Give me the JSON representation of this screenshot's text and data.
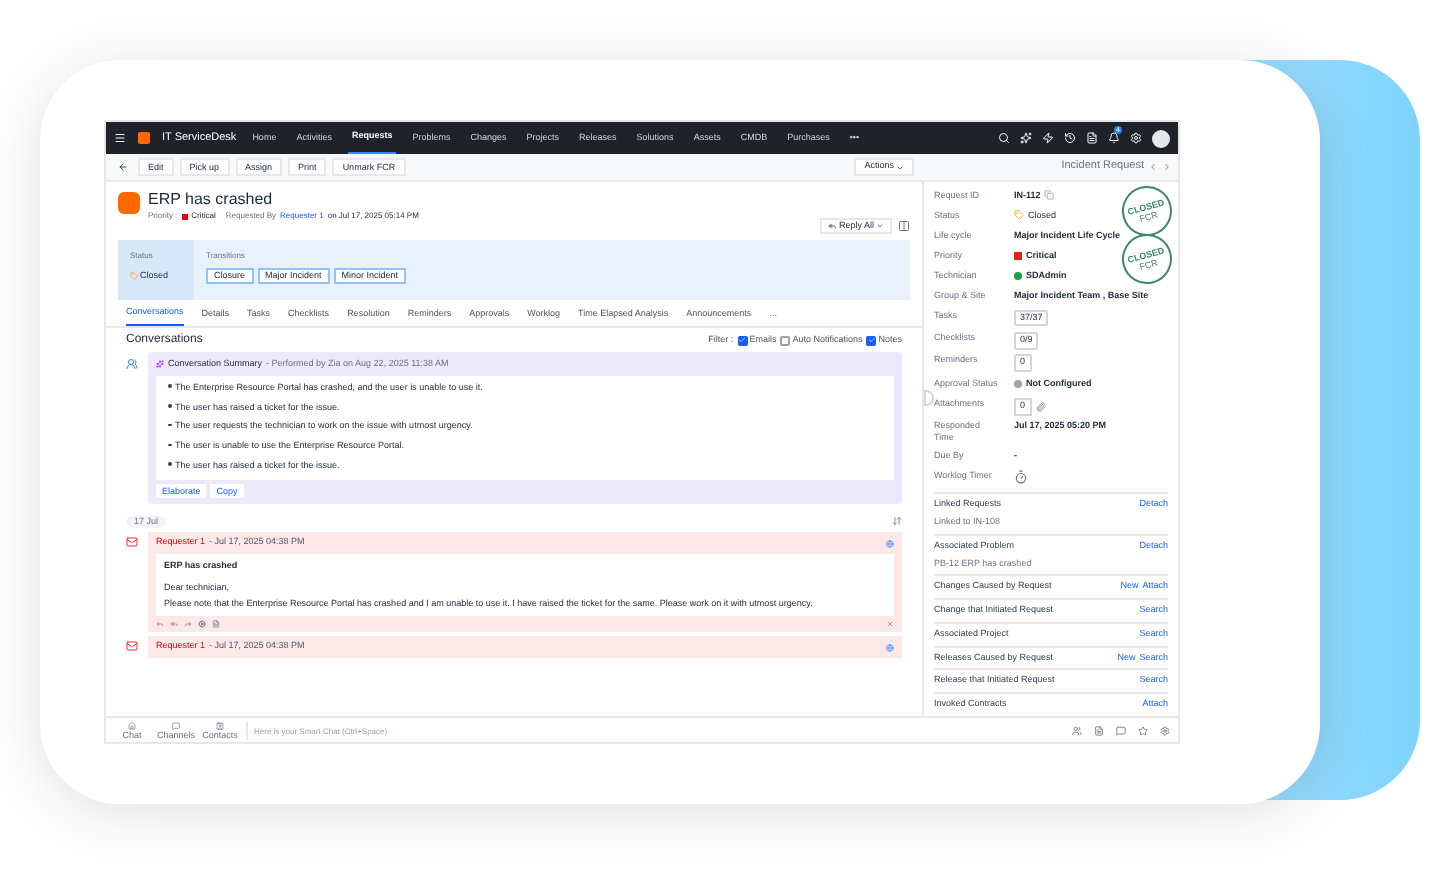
{
  "app": {
    "name": "IT ServiceDesk"
  },
  "nav": [
    {
      "label": "Home",
      "selected": false
    },
    {
      "label": "Activities",
      "selected": false
    },
    {
      "label": "Requests",
      "selected": true
    },
    {
      "label": "Problems",
      "selected": false
    },
    {
      "label": "Changes",
      "selected": false
    },
    {
      "label": "Projects",
      "selected": false
    },
    {
      "label": "Releases",
      "selected": false
    },
    {
      "label": "Solutions",
      "selected": false
    },
    {
      "label": "Assets",
      "selected": false
    },
    {
      "label": "CMDB",
      "selected": false
    },
    {
      "label": "Purchases",
      "selected": false
    },
    {
      "label": "•••",
      "selected": false
    }
  ],
  "notification_count": "4",
  "toolbar": {
    "buttons": [
      "Edit",
      "Pick up",
      "Assign",
      "Print",
      "Unmark FCR"
    ],
    "actions": "Actions",
    "panel_title": "Incident Request"
  },
  "request": {
    "title": "ERP has crashed",
    "priority_label": "Priority :",
    "priority": "Critical",
    "requested_by_label": "Requested By",
    "requester": "Requester 1",
    "requested_on": "on Jul 17, 2025 05:14 PM",
    "reply_all": "Reply All"
  },
  "status": {
    "label": "Status",
    "value": "Closed",
    "transitions_label": "Transitions",
    "transitions": [
      "Closure",
      "Major Incident",
      "Minor Incident"
    ]
  },
  "tabs": [
    {
      "label": "Conversations",
      "selected": true
    },
    {
      "label": "Details",
      "selected": false
    },
    {
      "label": "Tasks",
      "selected": false
    },
    {
      "label": "Checklists",
      "selected": false
    },
    {
      "label": "Resolution",
      "selected": false
    },
    {
      "label": "Reminders",
      "selected": false
    },
    {
      "label": "Approvals",
      "selected": false
    },
    {
      "label": "Worklog",
      "selected": false
    },
    {
      "label": "Time Elapsed Analysis",
      "selected": false
    },
    {
      "label": "Announcements",
      "selected": false
    },
    {
      "label": "...",
      "selected": false
    }
  ],
  "conversations": {
    "heading": "Conversations",
    "filter_label": "Filter :",
    "filters": [
      {
        "label": "Emails",
        "checked": true
      },
      {
        "label": "Auto Notifications",
        "checked": false
      },
      {
        "label": "Notes",
        "checked": true
      }
    ],
    "summary": {
      "title": "Conversation Summary",
      "meta": "- Performed by Zia on Aug 22, 2025 11:38 AM",
      "points": [
        "The Enterprise Resource Portal has crashed, and the user is unable to use it.",
        "The user has raised a ticket for the issue.",
        "The user requests the technician to work on the issue with utmost urgency.",
        "The user is unable to use the Enterprise Resource Portal.",
        "The user has raised a ticket for the issue."
      ],
      "actions": [
        "Elaborate",
        "Copy"
      ]
    },
    "date_chip": "17 Jul",
    "messages": [
      {
        "sender": "Requester 1",
        "time": "- Jul 17, 2025 04:38 PM",
        "expanded": true,
        "subject": "ERP has crashed",
        "greeting": "Dear technician,",
        "body": "Please note that the Enterprise Resource Portal has crashed and I am unable to use it. I have raised the ticket for the same. Please work on it with utmost urgency."
      },
      {
        "sender": "Requester 1",
        "time": "- Jul 17, 2025 04:38 PM",
        "expanded": false
      }
    ]
  },
  "details": [
    {
      "label": "Request ID",
      "value": "IN-112",
      "kind": "copy"
    },
    {
      "label": "Status",
      "value": "Closed",
      "kind": "status"
    },
    {
      "label": "Life cycle",
      "value": "Major Incident Life Cycle",
      "kind": "text"
    },
    {
      "label": "Priority",
      "value": "Critical",
      "kind": "square",
      "color": "#dc2626"
    },
    {
      "label": "Technician",
      "value": "SDAdmin",
      "kind": "dot",
      "color": "#16a34a"
    },
    {
      "label": "Group & Site",
      "value": "Major Incident Team , Base Site",
      "kind": "text"
    },
    {
      "label": "Tasks",
      "value": "37/37",
      "kind": "boxed"
    },
    {
      "label": "Checklists",
      "value": "0/9",
      "kind": "boxed"
    },
    {
      "label": "Reminders",
      "value": "0",
      "kind": "boxed"
    },
    {
      "label": "Approval Status",
      "value": "Not Configured",
      "kind": "dot",
      "color": "#9ca3af"
    },
    {
      "label": "Attachments",
      "value": "0",
      "kind": "attach"
    },
    {
      "label": "Responded Time",
      "value": "Jul 17, 2025 05:20 PM",
      "kind": "text"
    },
    {
      "label": "Due By",
      "value": "-",
      "kind": "text"
    },
    {
      "label": "Worklog Timer",
      "kind": "timer"
    }
  ],
  "stamps": [
    {
      "text": "CLOSED",
      "sub": "FCR"
    },
    {
      "text": "CLOSED",
      "sub": "FCR"
    }
  ],
  "linked": [
    {
      "title": "Linked Requests",
      "links": [
        "Detach"
      ],
      "note": "Linked to IN-108"
    },
    {
      "title": "Associated Problem",
      "links": [
        "Detach"
      ],
      "note": "PB-12 ERP has crashed"
    },
    {
      "title": "Changes Caused by Request",
      "links": [
        "New",
        "Attach"
      ]
    },
    {
      "title": "Change that Initiated Request",
      "links": [
        "Search"
      ]
    },
    {
      "title": "Associated Project",
      "links": [
        "Search"
      ]
    },
    {
      "title": "Releases Caused by Request",
      "links": [
        "New",
        "Search"
      ]
    },
    {
      "title": "Release that Initiated Request",
      "links": [
        "Search"
      ]
    },
    {
      "title": "Invoked Contracts",
      "links": [
        "Attach"
      ]
    }
  ],
  "smart_chat": {
    "placeholder": "Here is your Smart Chat (Ctrl+Space)",
    "shortcuts": [
      "Chat",
      "Channels",
      "Contacts"
    ]
  }
}
